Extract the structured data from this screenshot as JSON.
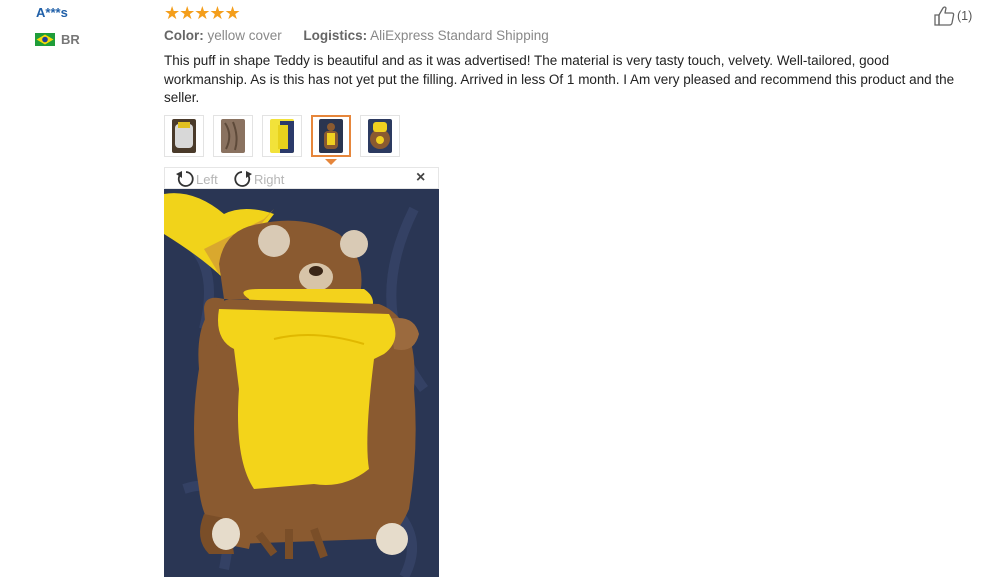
{
  "user": {
    "name": "A***s",
    "country": "BR"
  },
  "rating": {
    "stars": 5,
    "display": "★★★★★"
  },
  "meta": {
    "color_label": "Color:",
    "color_value": "yellow cover",
    "logistics_label": "Logistics:",
    "logistics_value": "AliExpress Standard Shipping"
  },
  "review_text": "This puff in shape Teddy is beautiful and as it was advertised! The material is very tasty touch, velvety. Well-tailored, good workmanship. As is this has not yet put the filling. Arrived in less Of 1 month. I Am very pleased and recommend this product and the seller.",
  "helpful": {
    "count": "(1)"
  },
  "thumbnails": {
    "count": 5,
    "selected_index": 3
  },
  "viewer": {
    "left_label": "Left",
    "right_label": "Right",
    "close_label": "×"
  },
  "colors": {
    "accent": "#e6863b",
    "star": "#f49e1b",
    "username": "#1f5fa8"
  }
}
